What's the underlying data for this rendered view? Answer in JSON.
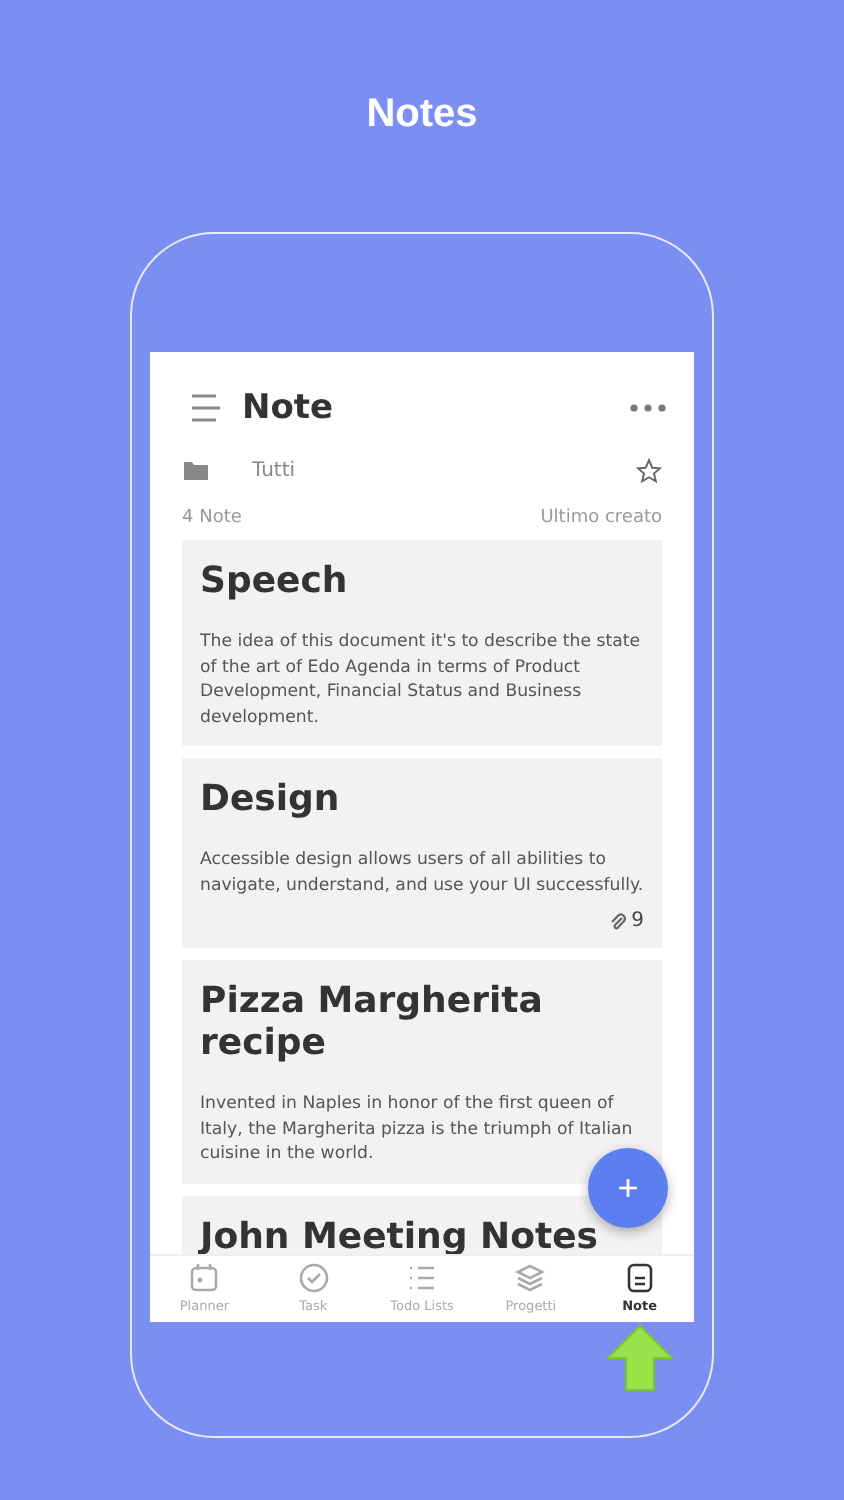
{
  "page_title": "Notes",
  "app_bar": {
    "title": "Note"
  },
  "filter": {
    "label": "Tutti",
    "starred": false
  },
  "list_info": {
    "count": "4 Note",
    "sort": "Ultimo creato"
  },
  "notes": [
    {
      "title": "Speech",
      "body": "The idea of this document it's to describe the state of the art of Edo Agenda in terms of Product Development, Financial Status and Business development."
    },
    {
      "title": "Design",
      "body": "Accessible design allows users of all abilities to navigate, understand, and use your UI successfully.",
      "attachments": "9"
    },
    {
      "title": "Pizza Margherita recipe",
      "body": "Invented in Naples in honor of the first queen of Italy, the Margherita pizza is the triumph of Italian cuisine in the world."
    },
    {
      "title": "John Meeting Notes"
    }
  ],
  "fab": {
    "label": "+"
  },
  "tabs": [
    {
      "kind": "planner",
      "label": "Planner",
      "selected": false
    },
    {
      "kind": "task",
      "label": "Task",
      "selected": false
    },
    {
      "kind": "lists",
      "label": "Todo Lists",
      "selected": false
    },
    {
      "kind": "projects",
      "label": "Progetti",
      "selected": false
    },
    {
      "kind": "note",
      "label": "Note",
      "selected": true
    }
  ]
}
